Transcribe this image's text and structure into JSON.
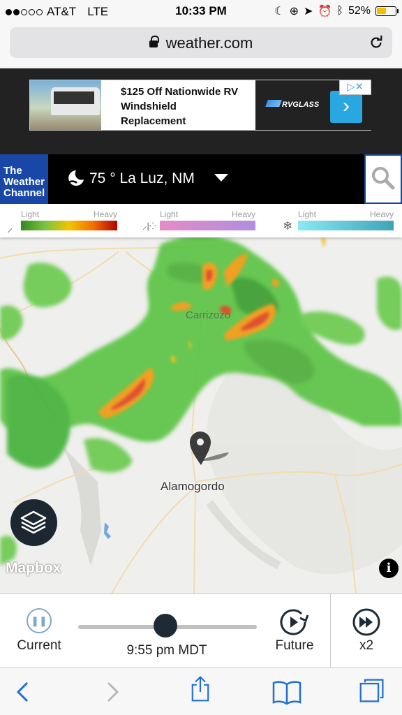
{
  "status": {
    "carrier": "AT&T",
    "network": "LTE",
    "time": "10:33 PM",
    "battery": "52%"
  },
  "browser": {
    "url": "weather.com"
  },
  "ad": {
    "line1": "$125 Off Nationwide RV",
    "line2": "Windshield",
    "line3": "Replacement",
    "brand": "RVGLASS"
  },
  "header": {
    "logo_line1": "The",
    "logo_line2": "Weather",
    "logo_line3": "Channel",
    "temperature": "75 °",
    "location": "La Luz, NM"
  },
  "legend": [
    {
      "icon": "rain-icon",
      "light": "Light",
      "heavy": "Heavy",
      "colors": [
        "#2e8b1e",
        "#7cc242",
        "#f2c500",
        "#f07000",
        "#b50000"
      ]
    },
    {
      "icon": "mix-icon",
      "light": "Light",
      "heavy": "Heavy",
      "colors": [
        "#e58bc5",
        "#b08fe0"
      ]
    },
    {
      "icon": "snow-icon",
      "light": "Light",
      "heavy": "Heavy",
      "colors": [
        "#8ce8f5",
        "#3fa3b8"
      ]
    }
  ],
  "map": {
    "city": "Alamogordo",
    "city_north": "Carrizozo",
    "attribution": "Mapbox"
  },
  "timeline": {
    "current_label": "Current",
    "time": "9:55 pm MDT",
    "future_label": "Future",
    "speed_label": "x2",
    "progress": 0.49
  },
  "colors": {
    "twc_blue": "#1847a8",
    "ios_blue": "#1f6fd6",
    "radar_green": "#5cc445"
  }
}
